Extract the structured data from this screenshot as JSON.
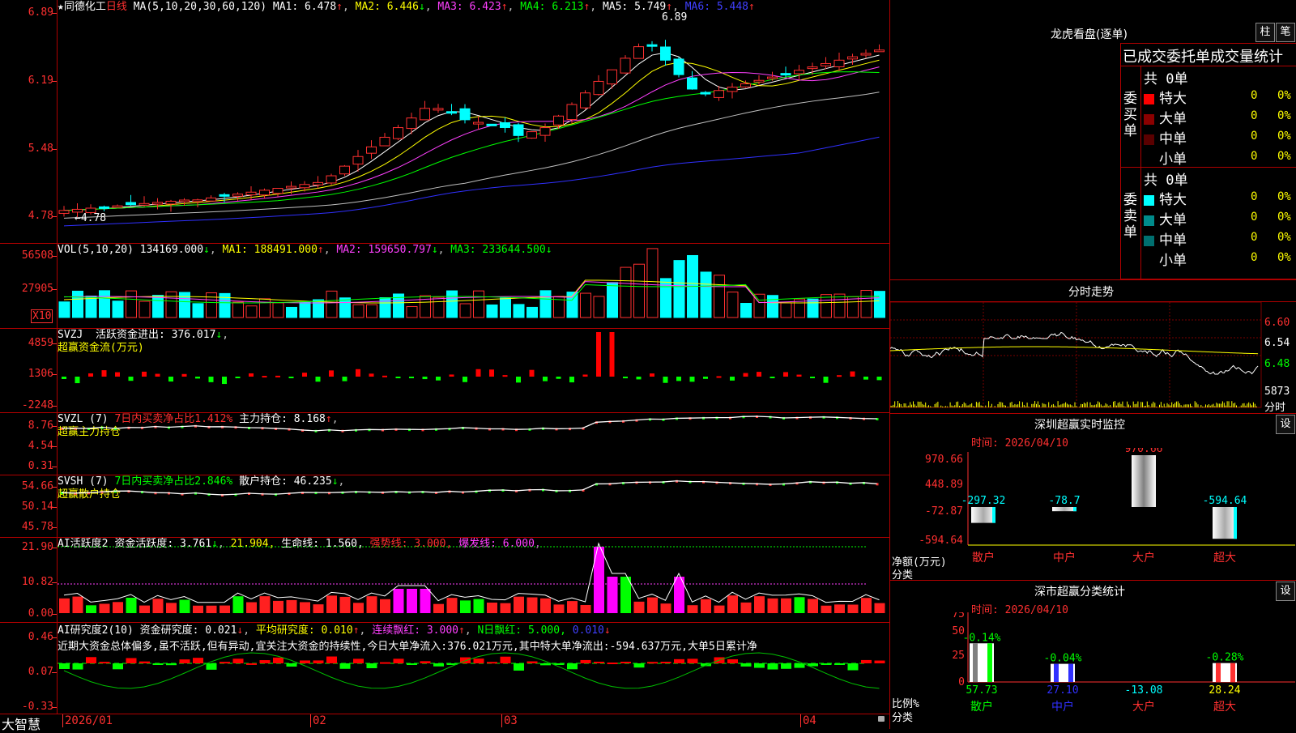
{
  "kline": {
    "star": "★",
    "stock_name": "同德化工",
    "period": "日线",
    "ma_label": "MA(5,10,20,30,60,120)",
    "ma1": "MA1: 6.478",
    "ma2": "MA2: 6.446",
    "ma3": "MA3: 6.423",
    "ma4": "MA4: 6.213",
    "ma5": "MA5: 5.749",
    "ma6": "MA6: 5.448",
    "up": "↑",
    "down": "↓",
    "y_labels": [
      "6.89",
      "6.19",
      "5.48",
      "4.78"
    ],
    "high_label": "6.89",
    "low_label": "←4.78",
    "colors": {
      "up": "#ff3030",
      "down": "#00ffff"
    }
  },
  "vol": {
    "label": "VOL(5,10,20)",
    "value": "134169.000",
    "ma1": "MA1: 188491.000",
    "ma2": "MA2: 159650.797",
    "ma3": "MA3: 233644.500",
    "y_labels": [
      "56508",
      "27905"
    ],
    "unit": "X10"
  },
  "svzj": {
    "label": "SVZJ",
    "desc": "活跃资金进出: 376.017",
    "sub": "超赢资金流(万元)",
    "y_labels": [
      "4859",
      "1306",
      "-2248"
    ]
  },
  "svzl": {
    "label": "SVZL (7)",
    "desc1": "7日内买卖净占比1.412%",
    "desc2": "主力持仓: 8.168",
    "sub": "超赢主力持仓",
    "y_labels": [
      "8.76",
      "4.54",
      "0.31"
    ]
  },
  "svsh": {
    "label": "SVSH (7)",
    "desc1": "7日内买卖净占比2.846%",
    "desc2": "散户持仓: 46.235",
    "sub": "超赢散户持仓",
    "y_labels": [
      "54.66",
      "50.14",
      "45.78"
    ]
  },
  "ai_active": {
    "label": "AI活跃度2",
    "desc1": "资金活跃度: 3.761",
    "desc2": "21.904,",
    "desc3": "生命线: 1.560,",
    "desc4": "强势线: 3.000,",
    "desc5": "爆发线: 6.000,",
    "y_labels": [
      "21.90",
      "10.82",
      "0.00"
    ]
  },
  "ai_research": {
    "label": "AI研究度2(10)",
    "desc1": "资金研究度: 0.021",
    "desc2": "平均研究度: 0.010",
    "desc3": "连续飘红: 3.000",
    "desc4": "N日飘红: 5.000,",
    "desc5": "0.010",
    "comment": "近期大资金总体偏多,虽不活跃,但有异动,宜关注大资金的持续性,今日大单净流入:376.021万元,其中特大单净流出:-594.637万元,大单5日累计净",
    "y_labels": [
      "0.46",
      "0.07",
      "-0.33"
    ]
  },
  "x_axis": {
    "brand": "大智慧",
    "labels": [
      "2026/01",
      "02",
      "03",
      "04"
    ],
    "lock_icon": "lock-icon"
  },
  "right": {
    "lhb_title": "龙虎看盘(逐单)",
    "btn_col": "柱",
    "btn_pen": "笔",
    "order_header": "已成交委托单成交量统计",
    "buy_side": "委买单",
    "sell_side": "委卖单",
    "buy_total": "共 0单",
    "sell_total": "共 0单",
    "buy_rows": [
      {
        "label": "特大",
        "count": "0",
        "pct": "0%",
        "color": "#ff0000"
      },
      {
        "label": "大单",
        "count": "0",
        "pct": "0%",
        "color": "#8b0000"
      },
      {
        "label": "中单",
        "count": "0",
        "pct": "0%",
        "color": "#5a0000"
      },
      {
        "label": "小单",
        "count": "0",
        "pct": "0%",
        "color": "#000000"
      }
    ],
    "sell_rows": [
      {
        "label": "特大",
        "count": "0",
        "pct": "0%",
        "color": "#00ffff"
      },
      {
        "label": "大单",
        "count": "0",
        "pct": "0%",
        "color": "#008b8b"
      },
      {
        "label": "中单",
        "count": "0",
        "pct": "0%",
        "color": "#006f6f"
      },
      {
        "label": "小单",
        "count": "0",
        "pct": "0%",
        "color": "#000000"
      }
    ],
    "minute_title": "分时走势",
    "minute_y": [
      "6.60",
      "6.54",
      "6.48"
    ],
    "minute_vol": "5873",
    "minute_unit": "分时",
    "monitor_title": "深圳超赢实时监控",
    "monitor_btn": "设",
    "monitor_date": "时间: 2026/04/10",
    "monitor_y": [
      "970.66",
      "448.89",
      "-72.87",
      "-594.64"
    ],
    "monitor_axis1": "净额(万元)",
    "monitor_axis2": "分类",
    "monitor_cats": [
      "散户",
      "中户",
      "大户",
      "超大"
    ],
    "monitor_vals": [
      "-297.32",
      "-78.7",
      "970.66",
      "-594.64"
    ],
    "stat_title": "深市超赢分类统计",
    "stat_btn": "设",
    "stat_date": "时间: 2026/04/10",
    "stat_y": [
      "75",
      "50",
      "25",
      "0"
    ],
    "stat_axis1": "比例%",
    "stat_axis2": "分类",
    "stat_cats": [
      "散户",
      "中户",
      "大户",
      "超大"
    ],
    "stat_top": [
      "-0.14%",
      "-0.04%",
      "",
      "-0.28%"
    ],
    "stat_vals": [
      "57.73",
      "27.10",
      "-13.08",
      "28.24"
    ]
  }
}
